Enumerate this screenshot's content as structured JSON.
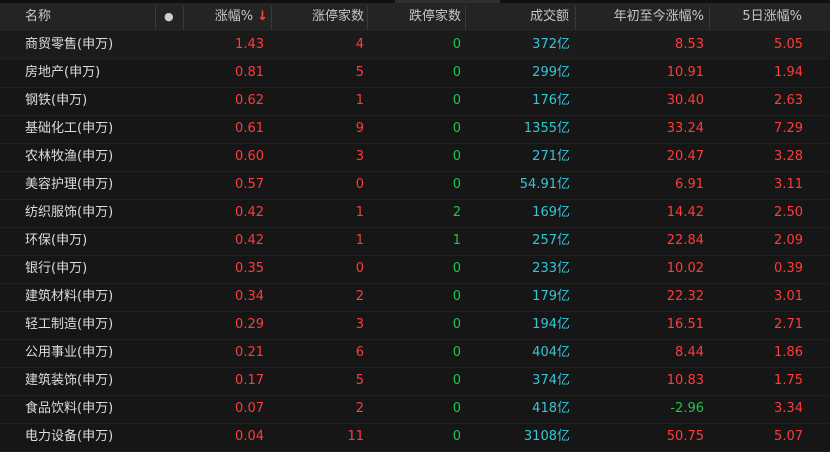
{
  "header": {
    "name": "名称",
    "dot": "●",
    "change_pct": "涨幅%",
    "sort_arrow": "↓",
    "limit_up": "涨停家数",
    "limit_down": "跌停家数",
    "volume": "成交额",
    "ytd": "年初至今涨幅%",
    "five_day": "5日涨幅%"
  },
  "colors": {
    "up": "#ff3b3b",
    "down": "#24c24c",
    "volume": "#33c6d6"
  },
  "rows": [
    {
      "name": "商贸零售(申万)",
      "change": "1.43",
      "up": "4",
      "down": "0",
      "volume": "372亿",
      "ytd": "8.53",
      "five_day": "5.05"
    },
    {
      "name": "房地产(申万)",
      "change": "0.81",
      "up": "5",
      "down": "0",
      "volume": "299亿",
      "ytd": "10.91",
      "five_day": "1.94"
    },
    {
      "name": "钢铁(申万)",
      "change": "0.62",
      "up": "1",
      "down": "0",
      "volume": "176亿",
      "ytd": "30.40",
      "five_day": "2.63"
    },
    {
      "name": "基础化工(申万)",
      "change": "0.61",
      "up": "9",
      "down": "0",
      "volume": "1355亿",
      "ytd": "33.24",
      "five_day": "7.29"
    },
    {
      "name": "农林牧渔(申万)",
      "change": "0.60",
      "up": "3",
      "down": "0",
      "volume": "271亿",
      "ytd": "20.47",
      "five_day": "3.28"
    },
    {
      "name": "美容护理(申万)",
      "change": "0.57",
      "up": "0",
      "down": "0",
      "volume": "54.91亿",
      "ytd": "6.91",
      "five_day": "3.11"
    },
    {
      "name": "纺织服饰(申万)",
      "change": "0.42",
      "up": "1",
      "down": "2",
      "volume": "169亿",
      "ytd": "14.42",
      "five_day": "2.50"
    },
    {
      "name": "环保(申万)",
      "change": "0.42",
      "up": "1",
      "down": "1",
      "volume": "257亿",
      "ytd": "22.84",
      "five_day": "2.09"
    },
    {
      "name": "银行(申万)",
      "change": "0.35",
      "up": "0",
      "down": "0",
      "volume": "233亿",
      "ytd": "10.02",
      "five_day": "0.39"
    },
    {
      "name": "建筑材料(申万)",
      "change": "0.34",
      "up": "2",
      "down": "0",
      "volume": "179亿",
      "ytd": "22.32",
      "five_day": "3.01"
    },
    {
      "name": "轻工制造(申万)",
      "change": "0.29",
      "up": "3",
      "down": "0",
      "volume": "194亿",
      "ytd": "16.51",
      "five_day": "2.71"
    },
    {
      "name": "公用事业(申万)",
      "change": "0.21",
      "up": "6",
      "down": "0",
      "volume": "404亿",
      "ytd": "8.44",
      "five_day": "1.86"
    },
    {
      "name": "建筑装饰(申万)",
      "change": "0.17",
      "up": "5",
      "down": "0",
      "volume": "374亿",
      "ytd": "10.83",
      "five_day": "1.75"
    },
    {
      "name": "食品饮料(申万)",
      "change": "0.07",
      "up": "2",
      "down": "0",
      "volume": "418亿",
      "ytd": "-2.96",
      "five_day": "3.34"
    },
    {
      "name": "电力设备(申万)",
      "change": "0.04",
      "up": "11",
      "down": "0",
      "volume": "3108亿",
      "ytd": "50.75",
      "five_day": "5.07"
    }
  ]
}
